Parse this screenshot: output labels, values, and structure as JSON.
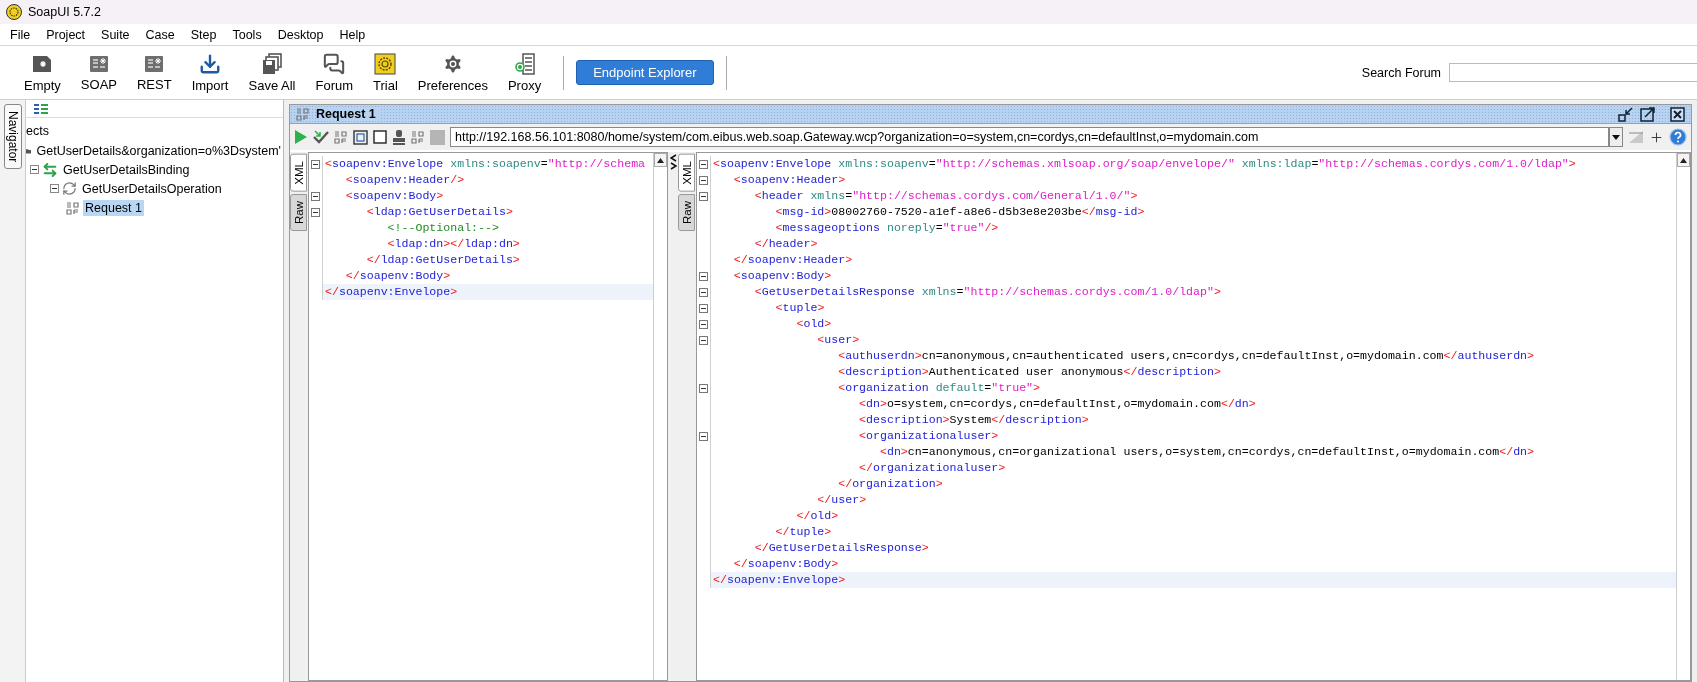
{
  "window": {
    "title": "SoapUI 5.7.2"
  },
  "menu": [
    "File",
    "Project",
    "Suite",
    "Case",
    "Step",
    "Tools",
    "Desktop",
    "Help"
  ],
  "toolbar": {
    "buttons": [
      {
        "kind": "empty",
        "label": "Empty"
      },
      {
        "kind": "soap",
        "label": "SOAP"
      },
      {
        "kind": "rest",
        "label": "REST"
      },
      {
        "kind": "import",
        "label": "Import"
      },
      {
        "kind": "save_all",
        "label": "Save All"
      },
      {
        "kind": "forum",
        "label": "Forum"
      },
      {
        "kind": "trial",
        "label": "Trial"
      },
      {
        "kind": "preferences",
        "label": "Preferences"
      },
      {
        "kind": "proxy",
        "label": "Proxy"
      }
    ],
    "endpoint_explorer": "Endpoint Explorer",
    "search": {
      "label": "Search Forum"
    }
  },
  "navigator": {
    "tab": "Navigator",
    "header": "ects",
    "tree": [
      {
        "kind": "project",
        "label": "GetUserDetails&organization=o%3Dsystem'",
        "selected": false,
        "children": [
          {
            "kind": "binding",
            "label": "GetUserDetailsBinding",
            "selected": false,
            "expanded": true,
            "children": [
              {
                "kind": "operation",
                "label": "GetUserDetailsOperation",
                "selected": false,
                "expanded": true,
                "children": [
                  {
                    "kind": "request",
                    "label": "Request 1",
                    "selected": true
                  }
                ]
              }
            ]
          }
        ]
      }
    ]
  },
  "request_panel": {
    "title": "Request 1",
    "url": "http://192.168.56.101:8080/home/system/com.eibus.web.soap.Gateway.wcp?organization=o=system,cn=cordys,cn=defaultInst,o=mydomain.com",
    "request": {
      "tabs": [
        {
          "label": "XML",
          "selected": true
        },
        {
          "label": "Raw",
          "selected": false
        }
      ],
      "lines": [
        {
          "fold": true,
          "current": false,
          "tokens": [
            {
              "kind": "bracket",
              "text": "<"
            },
            {
              "kind": "tag",
              "text": "soapenv:Envelope"
            },
            {
              "kind": "attr",
              "text": " xmlns:soapenv"
            },
            {
              "kind": "text",
              "text": "="
            },
            {
              "kind": "value",
              "text": "\"http://schema"
            }
          ],
          "children": [
            {
              "fold": false,
              "current": false,
              "tokens": [
                {
                  "kind": "bracket",
                  "text": "<"
                },
                {
                  "kind": "tag",
                  "text": "soapenv:Header"
                },
                {
                  "kind": "bracket",
                  "text": "/>"
                }
              ]
            },
            {
              "fold": true,
              "current": false,
              "tokens": [
                {
                  "kind": "bracket",
                  "text": "<"
                },
                {
                  "kind": "tag",
                  "text": "soapenv:Body"
                },
                {
                  "kind": "bracket",
                  "text": ">"
                }
              ],
              "children": [
                {
                  "fold": true,
                  "current": false,
                  "tokens": [
                    {
                      "kind": "bracket",
                      "text": "<"
                    },
                    {
                      "kind": "tag",
                      "text": "ldap:GetUserDetails"
                    },
                    {
                      "kind": "bracket",
                      "text": ">"
                    }
                  ],
                  "children": [
                    {
                      "fold": false,
                      "current": false,
                      "tokens": [
                        {
                          "kind": "comment",
                          "text": "<!--Optional:-->"
                        }
                      ]
                    },
                    {
                      "fold": false,
                      "current": false,
                      "tokens": [
                        {
                          "kind": "bracket",
                          "text": "<"
                        },
                        {
                          "kind": "tag",
                          "text": "ldap:dn"
                        },
                        {
                          "kind": "bracket",
                          "text": "></"
                        },
                        {
                          "kind": "tag",
                          "text": "ldap:dn"
                        },
                        {
                          "kind": "bracket",
                          "text": ">"
                        }
                      ]
                    }
                  ]
                },
                {
                  "fold": false,
                  "current": false,
                  "tokens": [
                    {
                      "kind": "bracket",
                      "text": "</"
                    },
                    {
                      "kind": "tag",
                      "text": "ldap:GetUserDetails"
                    },
                    {
                      "kind": "bracket",
                      "text": ">"
                    }
                  ]
                }
              ]
            },
            {
              "fold": false,
              "current": false,
              "tokens": [
                {
                  "kind": "bracket",
                  "text": "</"
                },
                {
                  "kind": "tag",
                  "text": "soapenv:Body"
                },
                {
                  "kind": "bracket",
                  "text": ">"
                }
              ]
            }
          ]
        },
        {
          "fold": false,
          "current": true,
          "tokens": [
            {
              "kind": "bracket",
              "text": "</"
            },
            {
              "kind": "tag",
              "text": "soapenv:Envelope"
            },
            {
              "kind": "bracket",
              "text": ">"
            }
          ]
        }
      ]
    },
    "response": {
      "tabs": [
        {
          "label": "XML",
          "selected": true
        },
        {
          "label": "Raw",
          "selected": false
        }
      ],
      "lines": [
        {
          "fold": true,
          "current": false,
          "tokens": [
            {
              "kind": "bracket",
              "text": "<"
            },
            {
              "kind": "tag",
              "text": "soapenv:Envelope"
            },
            {
              "kind": "attr",
              "text": " xmlns:soapenv"
            },
            {
              "kind": "text",
              "text": "="
            },
            {
              "kind": "value",
              "text": "\"http://schemas.xmlsoap.org/soap/envelope/\""
            },
            {
              "kind": "attr",
              "text": " xmlns:ldap"
            },
            {
              "kind": "text",
              "text": "="
            },
            {
              "kind": "value",
              "text": "\"http://schemas.cordys.com/1.0/ldap\""
            },
            {
              "kind": "bracket",
              "text": ">"
            }
          ],
          "children": [
            {
              "fold": true,
              "current": false,
              "tokens": [
                {
                  "kind": "bracket",
                  "text": "<"
                },
                {
                  "kind": "tag",
                  "text": "soapenv:Header"
                },
                {
                  "kind": "bracket",
                  "text": ">"
                }
              ],
              "children": [
                {
                  "fold": true,
                  "current": false,
                  "tokens": [
                    {
                      "kind": "bracket",
                      "text": "<"
                    },
                    {
                      "kind": "tag",
                      "text": "header"
                    },
                    {
                      "kind": "attr",
                      "text": " xmlns"
                    },
                    {
                      "kind": "text",
                      "text": "="
                    },
                    {
                      "kind": "value",
                      "text": "\"http://schemas.cordys.com/General/1.0/\""
                    },
                    {
                      "kind": "bracket",
                      "text": ">"
                    }
                  ],
                  "children": [
                    {
                      "fold": false,
                      "current": false,
                      "tokens": [
                        {
                          "kind": "bracket",
                          "text": "<"
                        },
                        {
                          "kind": "tag",
                          "text": "msg-id"
                        },
                        {
                          "kind": "bracket",
                          "text": ">"
                        },
                        {
                          "kind": "text",
                          "text": "08002760-7520-a1ef-a8e6-d5b3e8e203be"
                        },
                        {
                          "kind": "bracket",
                          "text": "</"
                        },
                        {
                          "kind": "tag",
                          "text": "msg-id"
                        },
                        {
                          "kind": "bracket",
                          "text": ">"
                        }
                      ]
                    },
                    {
                      "fold": false,
                      "current": false,
                      "tokens": [
                        {
                          "kind": "bracket",
                          "text": "<"
                        },
                        {
                          "kind": "tag",
                          "text": "messageoptions"
                        },
                        {
                          "kind": "attr",
                          "text": " noreply"
                        },
                        {
                          "kind": "text",
                          "text": "="
                        },
                        {
                          "kind": "value",
                          "text": "\"true\""
                        },
                        {
                          "kind": "bracket",
                          "text": "/>"
                        }
                      ]
                    }
                  ]
                },
                {
                  "fold": false,
                  "current": false,
                  "tokens": [
                    {
                      "kind": "bracket",
                      "text": "</"
                    },
                    {
                      "kind": "tag",
                      "text": "header"
                    },
                    {
                      "kind": "bracket",
                      "text": ">"
                    }
                  ]
                }
              ]
            },
            {
              "fold": false,
              "current": false,
              "tokens": [
                {
                  "kind": "bracket",
                  "text": "</"
                },
                {
                  "kind": "tag",
                  "text": "soapenv:Header"
                },
                {
                  "kind": "bracket",
                  "text": ">"
                }
              ]
            },
            {
              "fold": true,
              "current": false,
              "tokens": [
                {
                  "kind": "bracket",
                  "text": "<"
                },
                {
                  "kind": "tag",
                  "text": "soapenv:Body"
                },
                {
                  "kind": "bracket",
                  "text": ">"
                }
              ],
              "children": [
                {
                  "fold": true,
                  "current": false,
                  "tokens": [
                    {
                      "kind": "bracket",
                      "text": "<"
                    },
                    {
                      "kind": "tag",
                      "text": "GetUserDetailsResponse"
                    },
                    {
                      "kind": "attr",
                      "text": " xmlns"
                    },
                    {
                      "kind": "text",
                      "text": "="
                    },
                    {
                      "kind": "value",
                      "text": "\"http://schemas.cordys.com/1.0/ldap\""
                    },
                    {
                      "kind": "bracket",
                      "text": ">"
                    }
                  ],
                  "children": [
                    {
                      "fold": true,
                      "current": false,
                      "tokens": [
                        {
                          "kind": "bracket",
                          "text": "<"
                        },
                        {
                          "kind": "tag",
                          "text": "tuple"
                        },
                        {
                          "kind": "bracket",
                          "text": ">"
                        }
                      ],
                      "children": [
                        {
                          "fold": true,
                          "current": false,
                          "tokens": [
                            {
                              "kind": "bracket",
                              "text": "<"
                            },
                            {
                              "kind": "tag",
                              "text": "old"
                            },
                            {
                              "kind": "bracket",
                              "text": ">"
                            }
                          ],
                          "children": [
                            {
                              "fold": true,
                              "current": false,
                              "tokens": [
                                {
                                  "kind": "bracket",
                                  "text": "<"
                                },
                                {
                                  "kind": "tag",
                                  "text": "user"
                                },
                                {
                                  "kind": "bracket",
                                  "text": ">"
                                }
                              ],
                              "children": [
                                {
                                  "fold": false,
                                  "current": false,
                                  "tokens": [
                                    {
                                      "kind": "bracket",
                                      "text": "<"
                                    },
                                    {
                                      "kind": "tag",
                                      "text": "authuserdn"
                                    },
                                    {
                                      "kind": "bracket",
                                      "text": ">"
                                    },
                                    {
                                      "kind": "text",
                                      "text": "cn=anonymous,cn=authenticated users,cn=cordys,cn=defaultInst,o=mydomain.com"
                                    },
                                    {
                                      "kind": "bracket",
                                      "text": "</"
                                    },
                                    {
                                      "kind": "tag",
                                      "text": "authuserdn"
                                    },
                                    {
                                      "kind": "bracket",
                                      "text": ">"
                                    }
                                  ]
                                },
                                {
                                  "fold": false,
                                  "current": false,
                                  "tokens": [
                                    {
                                      "kind": "bracket",
                                      "text": "<"
                                    },
                                    {
                                      "kind": "tag",
                                      "text": "description"
                                    },
                                    {
                                      "kind": "bracket",
                                      "text": ">"
                                    },
                                    {
                                      "kind": "text",
                                      "text": "Authenticated user anonymous"
                                    },
                                    {
                                      "kind": "bracket",
                                      "text": "</"
                                    },
                                    {
                                      "kind": "tag",
                                      "text": "description"
                                    },
                                    {
                                      "kind": "bracket",
                                      "text": ">"
                                    }
                                  ]
                                },
                                {
                                  "fold": true,
                                  "current": false,
                                  "tokens": [
                                    {
                                      "kind": "bracket",
                                      "text": "<"
                                    },
                                    {
                                      "kind": "tag",
                                      "text": "organization"
                                    },
                                    {
                                      "kind": "attr",
                                      "text": " default"
                                    },
                                    {
                                      "kind": "text",
                                      "text": "="
                                    },
                                    {
                                      "kind": "value",
                                      "text": "\"true\""
                                    },
                                    {
                                      "kind": "bracket",
                                      "text": ">"
                                    }
                                  ],
                                  "children": [
                                    {
                                      "fold": false,
                                      "current": false,
                                      "tokens": [
                                        {
                                          "kind": "bracket",
                                          "text": "<"
                                        },
                                        {
                                          "kind": "tag",
                                          "text": "dn"
                                        },
                                        {
                                          "kind": "bracket",
                                          "text": ">"
                                        },
                                        {
                                          "kind": "text",
                                          "text": "o=system,cn=cordys,cn=defaultInst,o=mydomain.com"
                                        },
                                        {
                                          "kind": "bracket",
                                          "text": "</"
                                        },
                                        {
                                          "kind": "tag",
                                          "text": "dn"
                                        },
                                        {
                                          "kind": "bracket",
                                          "text": ">"
                                        }
                                      ]
                                    },
                                    {
                                      "fold": false,
                                      "current": false,
                                      "tokens": [
                                        {
                                          "kind": "bracket",
                                          "text": "<"
                                        },
                                        {
                                          "kind": "tag",
                                          "text": "description"
                                        },
                                        {
                                          "kind": "bracket",
                                          "text": ">"
                                        },
                                        {
                                          "kind": "text",
                                          "text": "System"
                                        },
                                        {
                                          "kind": "bracket",
                                          "text": "</"
                                        },
                                        {
                                          "kind": "tag",
                                          "text": "description"
                                        },
                                        {
                                          "kind": "bracket",
                                          "text": ">"
                                        }
                                      ]
                                    },
                                    {
                                      "fold": true,
                                      "current": false,
                                      "tokens": [
                                        {
                                          "kind": "bracket",
                                          "text": "<"
                                        },
                                        {
                                          "kind": "tag",
                                          "text": "organizationaluser"
                                        },
                                        {
                                          "kind": "bracket",
                                          "text": ">"
                                        }
                                      ],
                                      "children": [
                                        {
                                          "fold": false,
                                          "current": false,
                                          "tokens": [
                                            {
                                              "kind": "bracket",
                                              "text": "<"
                                            },
                                            {
                                              "kind": "tag",
                                              "text": "dn"
                                            },
                                            {
                                              "kind": "bracket",
                                              "text": ">"
                                            },
                                            {
                                              "kind": "text",
                                              "text": "cn=anonymous,cn=organizational users,o=system,cn=cordys,cn=defaultInst,o=mydomain.com"
                                            },
                                            {
                                              "kind": "bracket",
                                              "text": "</"
                                            },
                                            {
                                              "kind": "tag",
                                              "text": "dn"
                                            },
                                            {
                                              "kind": "bracket",
                                              "text": ">"
                                            }
                                          ]
                                        }
                                      ]
                                    },
                                    {
                                      "fold": false,
                                      "current": false,
                                      "tokens": [
                                        {
                                          "kind": "bracket",
                                          "text": "</"
                                        },
                                        {
                                          "kind": "tag",
                                          "text": "organizationaluser"
                                        },
                                        {
                                          "kind": "bracket",
                                          "text": ">"
                                        }
                                      ]
                                    }
                                  ]
                                },
                                {
                                  "fold": false,
                                  "current": false,
                                  "tokens": [
                                    {
                                      "kind": "bracket",
                                      "text": "</"
                                    },
                                    {
                                      "kind": "tag",
                                      "text": "organization"
                                    },
                                    {
                                      "kind": "bracket",
                                      "text": ">"
                                    }
                                  ]
                                }
                              ]
                            },
                            {
                              "fold": false,
                              "current": false,
                              "tokens": [
                                {
                                  "kind": "bracket",
                                  "text": "</"
                                },
                                {
                                  "kind": "tag",
                                  "text": "user"
                                },
                                {
                                  "kind": "bracket",
                                  "text": ">"
                                }
                              ]
                            }
                          ]
                        },
                        {
                          "fold": false,
                          "current": false,
                          "tokens": [
                            {
                              "kind": "bracket",
                              "text": "</"
                            },
                            {
                              "kind": "tag",
                              "text": "old"
                            },
                            {
                              "kind": "bracket",
                              "text": ">"
                            }
                          ]
                        }
                      ]
                    },
                    {
                      "fold": false,
                      "current": false,
                      "tokens": [
                        {
                          "kind": "bracket",
                          "text": "</"
                        },
                        {
                          "kind": "tag",
                          "text": "tuple"
                        },
                        {
                          "kind": "bracket",
                          "text": ">"
                        }
                      ]
                    }
                  ]
                },
                {
                  "fold": false,
                  "current": false,
                  "tokens": [
                    {
                      "kind": "bracket",
                      "text": "</"
                    },
                    {
                      "kind": "tag",
                      "text": "GetUserDetailsResponse"
                    },
                    {
                      "kind": "bracket",
                      "text": ">"
                    }
                  ]
                }
              ]
            },
            {
              "fold": false,
              "current": false,
              "tokens": [
                {
                  "kind": "bracket",
                  "text": "</"
                },
                {
                  "kind": "tag",
                  "text": "soapenv:Body"
                },
                {
                  "kind": "bracket",
                  "text": ">"
                }
              ]
            }
          ]
        },
        {
          "fold": false,
          "current": true,
          "tokens": [
            {
              "kind": "bracket",
              "text": "</"
            },
            {
              "kind": "tag",
              "text": "soapenv:Envelope"
            },
            {
              "kind": "bracket",
              "text": ">"
            }
          ]
        }
      ]
    }
  }
}
